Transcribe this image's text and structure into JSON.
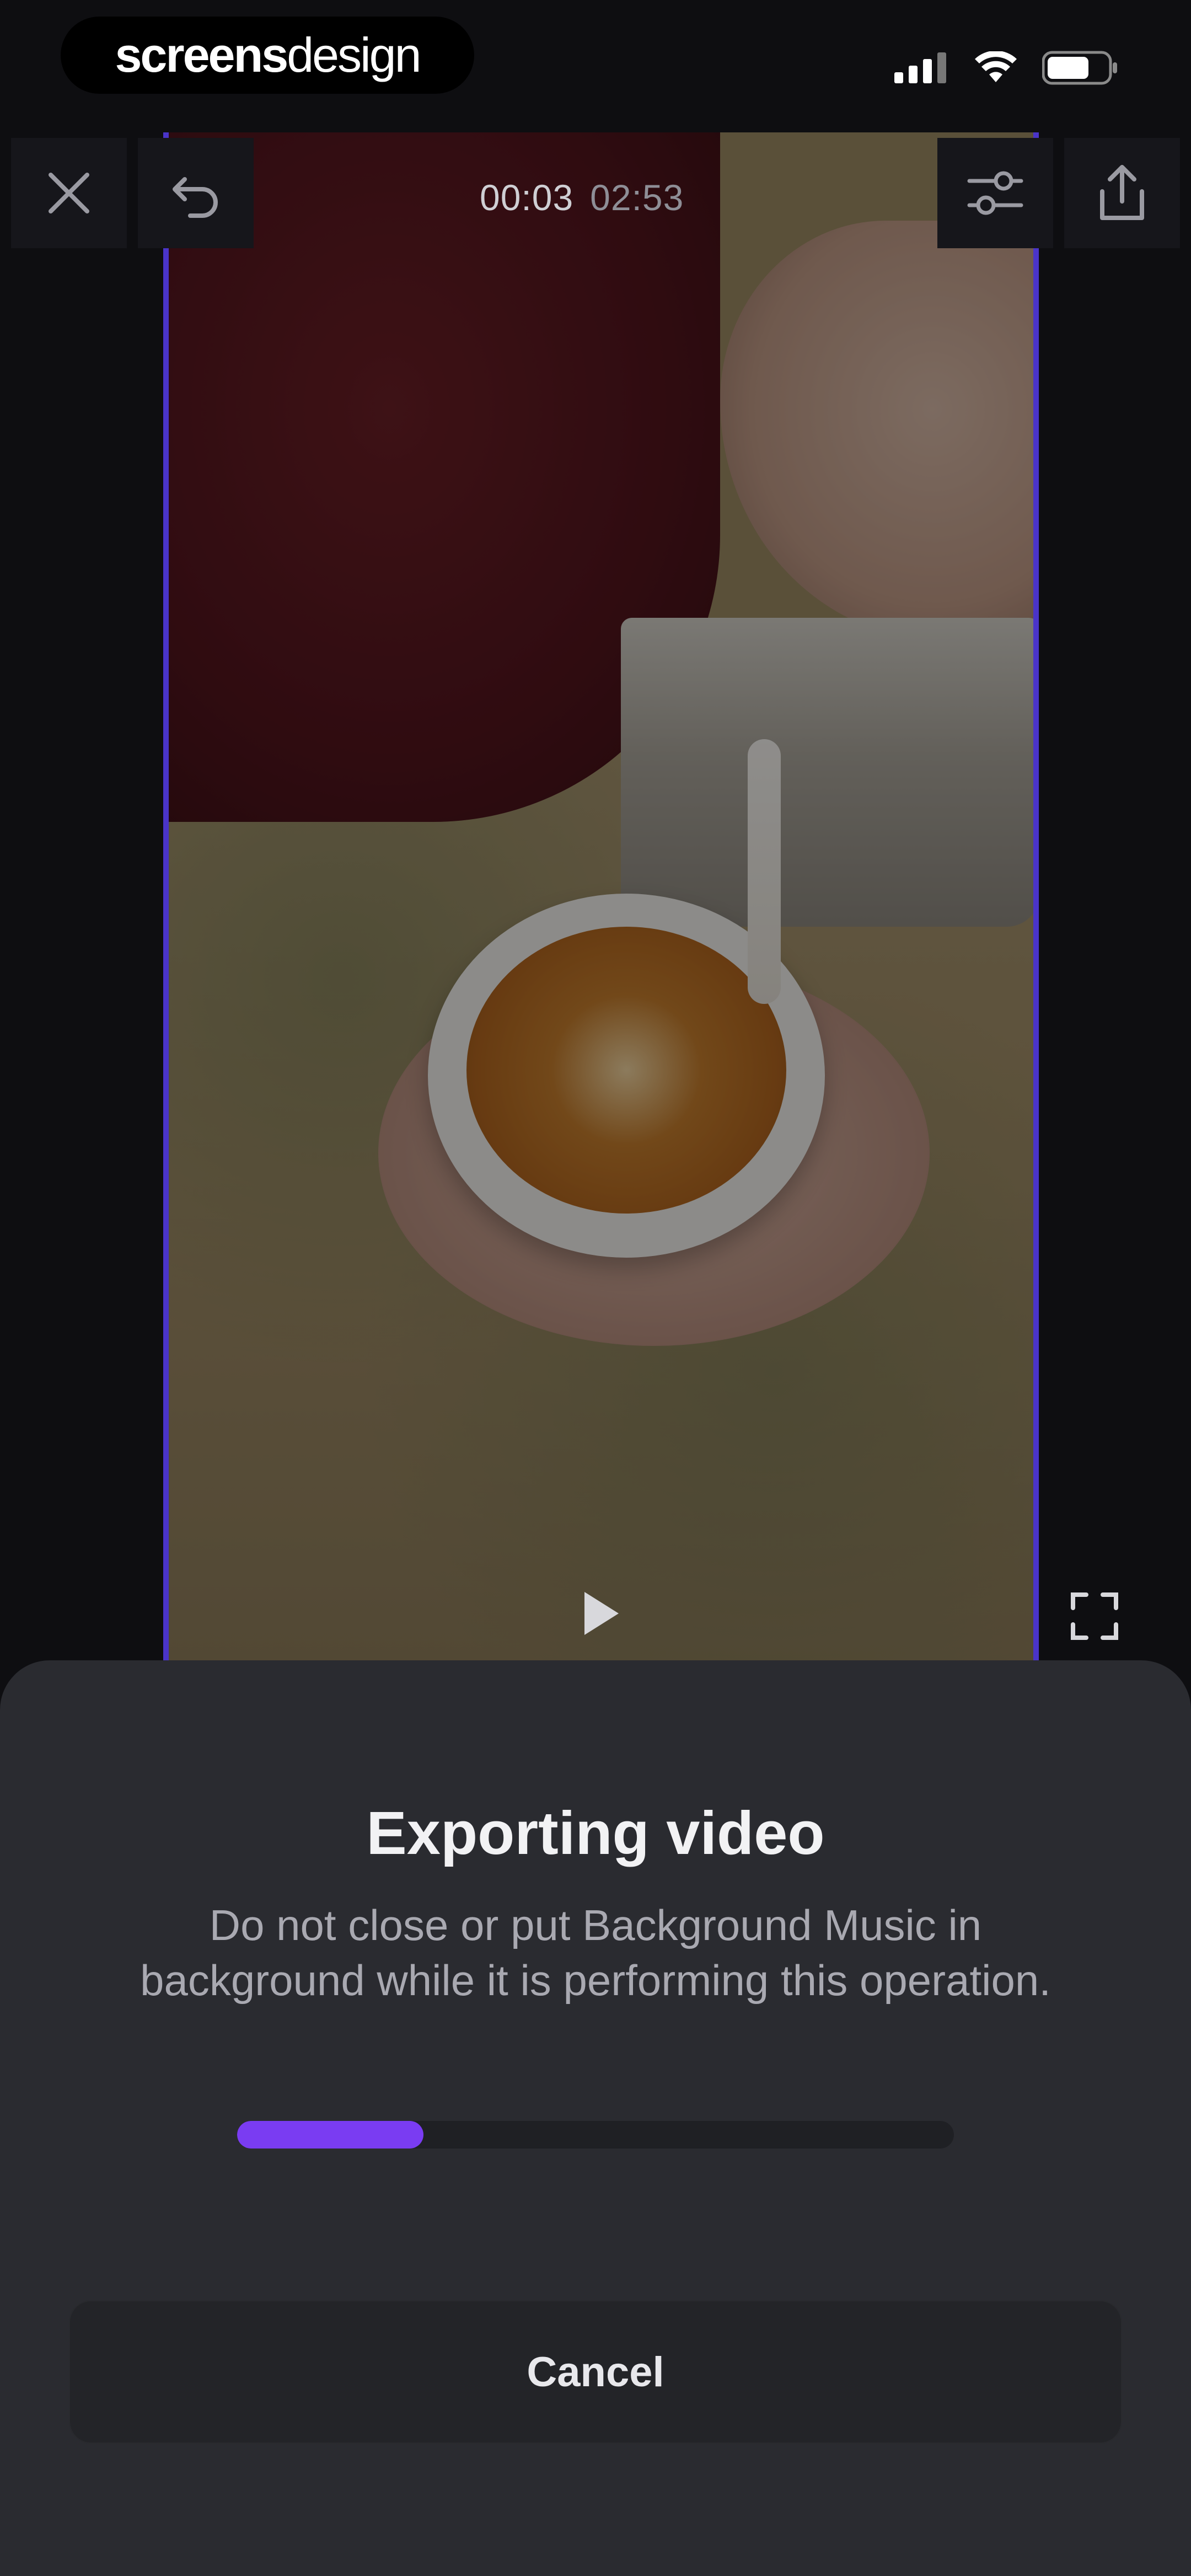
{
  "status_bar": {
    "brand_bold": "screens",
    "brand_light": "design",
    "icons": [
      "cellular-signal-icon",
      "wifi-icon",
      "battery-icon"
    ]
  },
  "toolbar": {
    "current_time": "00:03",
    "total_time": "02:53",
    "icons": [
      "close-icon",
      "undo-icon",
      "adjustments-icon",
      "share-icon"
    ]
  },
  "preview": {
    "icons": [
      "play-icon",
      "fullscreen-icon"
    ]
  },
  "export_sheet": {
    "title": "Exporting video",
    "description": "Do not close or put Background Music in background while it is performing this operation.",
    "progress": 0.26,
    "cancel_label": "Cancel",
    "accent_color": "#7a3cf2"
  }
}
